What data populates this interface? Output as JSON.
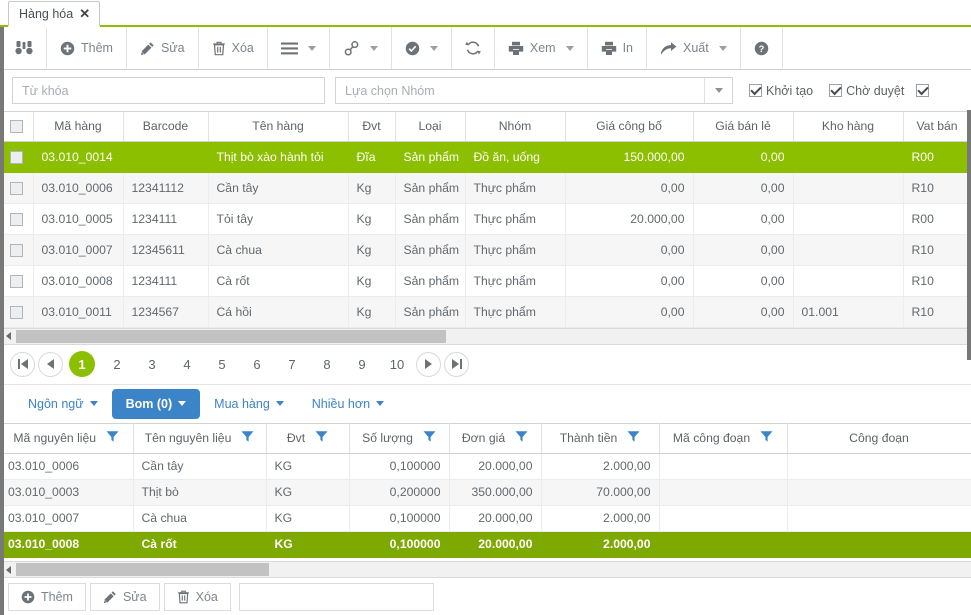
{
  "tab": {
    "label": "Hàng hóa",
    "close": "✕"
  },
  "toolbar": {
    "buttons": [
      {
        "name": "search-binoculars-button",
        "icon": "binoculars-icon",
        "label": "",
        "caret": false
      },
      {
        "name": "add-button",
        "icon": "plus-circle-icon",
        "label": "Thêm",
        "caret": false
      },
      {
        "name": "edit-button",
        "icon": "pencil-icon",
        "label": "Sửa",
        "caret": false
      },
      {
        "name": "delete-button",
        "icon": "trash-icon",
        "label": "Xóa",
        "caret": false
      },
      {
        "name": "menu-button",
        "icon": "hamburger-icon",
        "label": "",
        "caret": true
      },
      {
        "name": "link-button",
        "icon": "link-icon",
        "label": "",
        "caret": true
      },
      {
        "name": "approve-button",
        "icon": "check-circle-icon",
        "label": "",
        "caret": true
      },
      {
        "name": "refresh-button",
        "icon": "refresh-icon",
        "label": "",
        "caret": false
      },
      {
        "name": "view-button",
        "icon": "printer-icon",
        "label": "Xem",
        "caret": true
      },
      {
        "name": "print-button",
        "icon": "printer-icon",
        "label": "In",
        "caret": false
      },
      {
        "name": "export-button",
        "icon": "arrow-export-icon",
        "label": "Xuất",
        "caret": true
      },
      {
        "name": "help-button",
        "icon": "question-circle-icon",
        "label": "",
        "caret": false
      }
    ]
  },
  "filterbar": {
    "keyword_placeholder": "Từ khóa",
    "keyword_value": "",
    "group_placeholder": "Lựa chọn Nhóm",
    "group_value": "",
    "checkboxes": [
      {
        "label": "Khởi tạo",
        "checked": true
      },
      {
        "label": "Chờ duyệt",
        "checked": true
      }
    ]
  },
  "main_grid": {
    "columns": [
      "",
      "Mã hàng",
      "Barcode",
      "Tên hàng",
      "Đvt",
      "Loại",
      "Nhóm",
      "Giá công bố",
      "Giá bán lẻ",
      "Kho hàng",
      "Vat bán"
    ],
    "rows": [
      {
        "selected": true,
        "cells": [
          "03.010_0014",
          "",
          "Thịt bò xào hành tỏi",
          "Đĩa",
          "Sản phẩm",
          "Đồ ăn, uống",
          "150.000,00",
          "0,00",
          "",
          "R00"
        ]
      },
      {
        "selected": false,
        "cells": [
          "03.010_0006",
          "12341112",
          "Cần tây",
          "Kg",
          "Sản phẩm",
          "Thực phẩm",
          "0,00",
          "0,00",
          "",
          "R10"
        ]
      },
      {
        "selected": false,
        "cells": [
          "03.010_0005",
          "1234111",
          "Tỏi tây",
          "Kg",
          "Sản phẩm",
          "Thực phẩm",
          "20.000,00",
          "0,00",
          "",
          "R00"
        ]
      },
      {
        "selected": false,
        "cells": [
          "03.010_0007",
          "12345611",
          "Cà chua",
          "Kg",
          "Sản phẩm",
          "Thực phẩm",
          "0,00",
          "0,00",
          "",
          "R10"
        ]
      },
      {
        "selected": false,
        "cells": [
          "03.010_0008",
          "1234111",
          "Cà rốt",
          "Kg",
          "Sản phẩm",
          "Thực phẩm",
          "0,00",
          "0,00",
          "",
          "R10"
        ]
      },
      {
        "selected": false,
        "cells": [
          "03.010_0011",
          "1234567",
          "Cá hồi",
          "Kg",
          "Sản phẩm",
          "Thực phẩm",
          "0,00",
          "0,00",
          "01.001",
          "R10"
        ]
      }
    ]
  },
  "pagination": {
    "pages": [
      "1",
      "2",
      "3",
      "4",
      "5",
      "6",
      "7",
      "8",
      "9",
      "10"
    ],
    "active": "1"
  },
  "subtabs": [
    {
      "label": "Ngôn ngữ",
      "active": false
    },
    {
      "label": "Bom (0)",
      "active": true
    },
    {
      "label": "Mua hàng",
      "active": false
    },
    {
      "label": "Nhiều hơn",
      "active": false
    }
  ],
  "bom_grid": {
    "columns": [
      {
        "label": "Mã nguyên liệu",
        "filter": true
      },
      {
        "label": "Tên nguyên liệu",
        "filter": true
      },
      {
        "label": "Đvt",
        "filter": true
      },
      {
        "label": "Số lượng",
        "filter": true
      },
      {
        "label": "Đơn giá",
        "filter": true
      },
      {
        "label": "Thành tiền",
        "filter": true
      },
      {
        "label": "Mã công đoạn",
        "filter": true
      },
      {
        "label": "Công đoạn",
        "filter": false
      }
    ],
    "rows": [
      {
        "selected": false,
        "cells": [
          "03.010_0006",
          "Cần tây",
          "KG",
          "0,100000",
          "20.000,00",
          "2.000,00",
          "",
          ""
        ]
      },
      {
        "selected": false,
        "cells": [
          "03.010_0003",
          "Thịt bò",
          "KG",
          "0,200000",
          "350.000,00",
          "70.000,00",
          "",
          ""
        ]
      },
      {
        "selected": false,
        "cells": [
          "03.010_0007",
          "Cà chua",
          "KG",
          "0,100000",
          "20.000,00",
          "2.000,00",
          "",
          ""
        ]
      },
      {
        "selected": true,
        "cells": [
          "03.010_0008",
          "Cà rốt",
          "KG",
          "0,100000",
          "20.000,00",
          "2.000,00",
          "",
          ""
        ]
      }
    ]
  },
  "bottom_toolbar": {
    "buttons": [
      {
        "name": "bom-add-button",
        "icon": "plus-circle-icon",
        "label": "Thêm"
      },
      {
        "name": "bom-edit-button",
        "icon": "pencil-icon",
        "label": "Sửa"
      },
      {
        "name": "bom-delete-button",
        "icon": "trash-icon",
        "label": "Xóa"
      }
    ],
    "input_value": ""
  },
  "colors": {
    "accent_green": "#8cbf00",
    "selected_green": "#7ea900",
    "tab_blue": "#3c84c8",
    "filter_blue": "#3c84c8"
  }
}
